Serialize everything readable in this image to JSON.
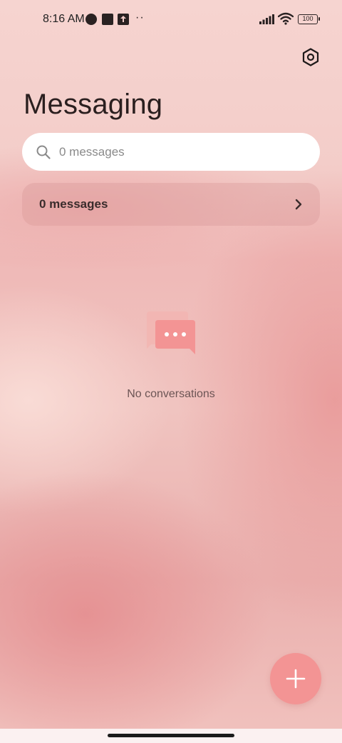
{
  "status_bar": {
    "time": "8:16 AM",
    "icons": [
      "notification-icon",
      "square-icon",
      "upload-icon",
      "more-dots-icon"
    ],
    "dots": "··",
    "battery": "100"
  },
  "header": {
    "title": "Messaging",
    "settings_icon": "settings-hexagon-icon"
  },
  "search": {
    "placeholder": "0 messages",
    "value": ""
  },
  "messages_card": {
    "label": "0 messages"
  },
  "empty_state": {
    "icon": "chat-bubbles-icon",
    "text": "No conversations"
  },
  "fab": {
    "icon": "plus-icon"
  },
  "colors": {
    "accent": "#f39494",
    "background": "#f3cdc9",
    "text_dark": "#2a1f1f"
  }
}
